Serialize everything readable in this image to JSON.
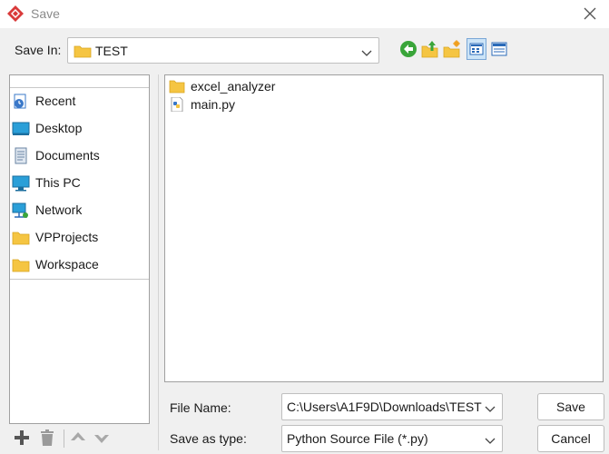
{
  "window": {
    "title": "Save",
    "app_icon": "visual-paradigm-diamond-icon",
    "close_icon": "close-icon"
  },
  "save_in": {
    "label": "Save In:",
    "value": "TEST",
    "icon": "folder-icon"
  },
  "toolbar": {
    "icons": [
      "back-icon",
      "up-folder-icon",
      "new-folder-icon",
      "list-view-icon",
      "details-view-icon"
    ]
  },
  "places": {
    "items": [
      {
        "label": "Recent",
        "icon": "recent-icon"
      },
      {
        "label": "Desktop",
        "icon": "desktop-icon"
      },
      {
        "label": "Documents",
        "icon": "documents-icon"
      },
      {
        "label": "This PC",
        "icon": "computer-icon"
      },
      {
        "label": "Network",
        "icon": "network-icon"
      },
      {
        "label": "VPProjects",
        "icon": "folder-icon"
      },
      {
        "label": "Workspace",
        "icon": "folder-icon"
      }
    ],
    "tools": [
      "add-icon",
      "trash-icon",
      "move-up-icon",
      "move-down-icon"
    ]
  },
  "files": [
    {
      "name": "excel_analyzer",
      "icon": "folder-icon"
    },
    {
      "name": "main.py",
      "icon": "python-file-icon"
    }
  ],
  "form": {
    "file_name_label": "File Name:",
    "file_name_value": "C:\\Users\\A1F9D\\Downloads\\TEST",
    "type_label": "Save as type:",
    "type_value": "Python Source File (*.py)"
  },
  "buttons": {
    "save": "Save",
    "cancel": "Cancel"
  },
  "colors": {
    "accent_red": "#d93a3a",
    "folder_yellow": "#f5c542",
    "back_green": "#3aa53a",
    "selection_blue": "#cce4f7"
  }
}
